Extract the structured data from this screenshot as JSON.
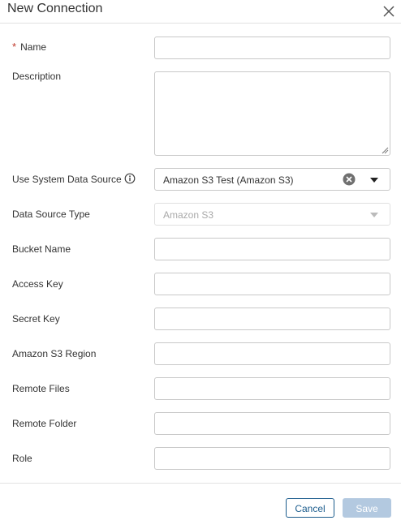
{
  "dialog": {
    "title": "New Connection",
    "close_icon": "close-icon"
  },
  "form": {
    "name": {
      "label": "Name",
      "required_marker": "*",
      "value": ""
    },
    "description": {
      "label": "Description",
      "value": ""
    },
    "use_system_data_source": {
      "label": "Use System Data Source",
      "info_icon": "info-icon",
      "selected": "Amazon S3 Test (Amazon S3)"
    },
    "data_source_type": {
      "label": "Data Source Type",
      "selected": "Amazon S3",
      "disabled": true
    },
    "bucket_name": {
      "label": "Bucket Name",
      "value": ""
    },
    "access_key": {
      "label": "Access Key",
      "value": ""
    },
    "secret_key": {
      "label": "Secret Key",
      "value": ""
    },
    "amazon_s3_region": {
      "label": "Amazon S3 Region",
      "value": ""
    },
    "remote_files": {
      "label": "Remote Files",
      "value": ""
    },
    "remote_folder": {
      "label": "Remote Folder",
      "value": ""
    },
    "role": {
      "label": "Role",
      "value": ""
    }
  },
  "footer": {
    "cancel_label": "Cancel",
    "save_label": "Save"
  },
  "colors": {
    "required": "#c0392b",
    "primary": "#1a5b8c",
    "save_disabled": "#b3c9e0",
    "border": "#c8c8c8"
  }
}
